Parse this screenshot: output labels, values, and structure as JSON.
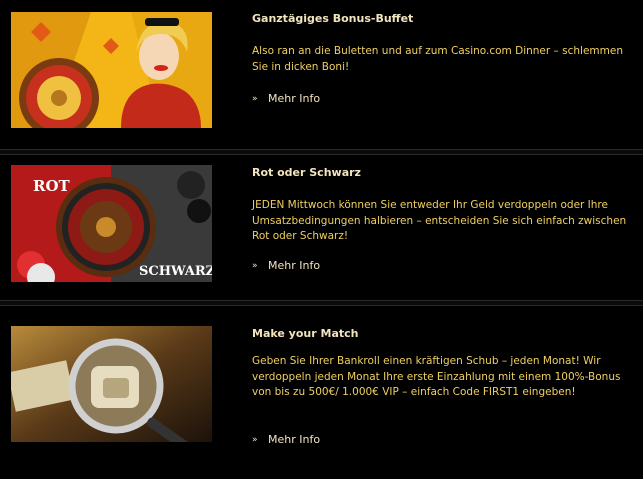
{
  "promos": [
    {
      "title": "Ganztägiges Bonus-Buffet",
      "description": "Also ran an die Buletten und auf zum Casino.com Dinner – schlemmen Sie in dicken Boni!",
      "more_label": "Mehr Info"
    },
    {
      "title": "Rot oder Schwarz",
      "description": "JEDEN Mittwoch können Sie entweder Ihr Geld verdoppeln oder Ihre Umsatzbedingungen halbieren – entscheiden Sie sich einfach zwischen Rot oder Schwarz!",
      "more_label": "Mehr Info",
      "image_text_top": "ROT",
      "image_text_bottom": "SCHWARZ"
    },
    {
      "title": "Make your Match",
      "description": "Geben Sie Ihrer Bankroll einen kräftigen Schub – jeden Monat! Wir verdoppeln jeden Monat Ihre erste Einzahlung mit einem 100%-Bonus von bis zu 500€/ 1.000€ VIP – einfach Code FIRST1 eingeben!",
      "more_label": "Mehr Info"
    }
  ],
  "colors": {
    "background": "#000000",
    "title": "#f2e4bd",
    "text": "#f0d060",
    "divider": "#2a2a2a"
  },
  "icons": {
    "more_arrow": "double-chevron-right-icon"
  }
}
